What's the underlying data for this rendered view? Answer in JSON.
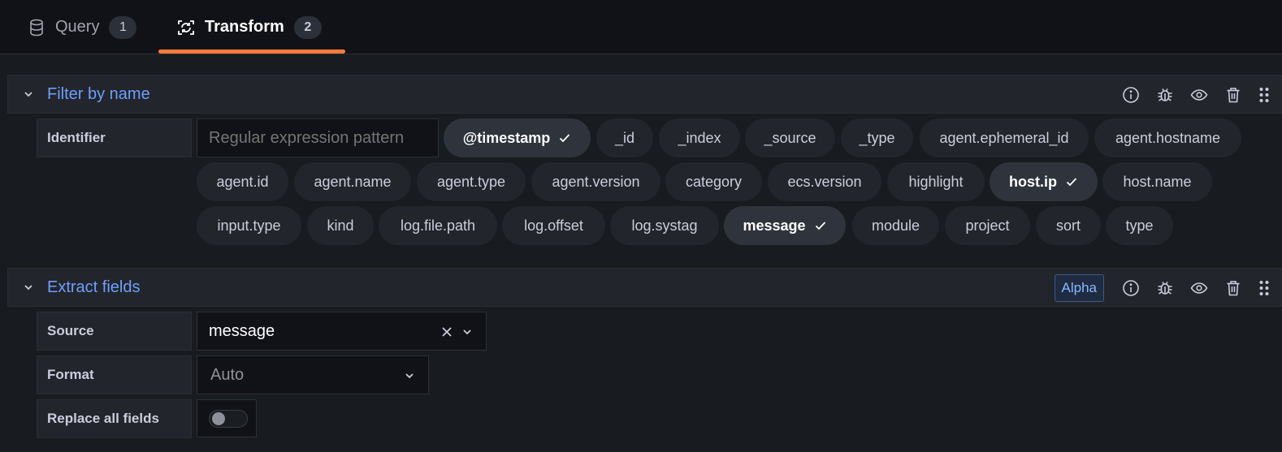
{
  "tabs": [
    {
      "label": "Query",
      "count": "1",
      "icon": "database-icon"
    },
    {
      "label": "Transform",
      "count": "2",
      "icon": "transform-icon"
    }
  ],
  "filter": {
    "title": "Filter by name",
    "identifier_label": "Identifier",
    "pattern_placeholder": "Regular expression pattern",
    "fields": [
      {
        "label": "@timestamp",
        "selected": true
      },
      {
        "label": "_id",
        "selected": false
      },
      {
        "label": "_index",
        "selected": false
      },
      {
        "label": "_source",
        "selected": false
      },
      {
        "label": "_type",
        "selected": false
      },
      {
        "label": "agent.ephemeral_id",
        "selected": false
      },
      {
        "label": "agent.hostname",
        "selected": false
      },
      {
        "label": "agent.id",
        "selected": false
      },
      {
        "label": "agent.name",
        "selected": false
      },
      {
        "label": "agent.type",
        "selected": false
      },
      {
        "label": "agent.version",
        "selected": false
      },
      {
        "label": "category",
        "selected": false
      },
      {
        "label": "ecs.version",
        "selected": false
      },
      {
        "label": "highlight",
        "selected": false
      },
      {
        "label": "host.ip",
        "selected": true
      },
      {
        "label": "host.name",
        "selected": false
      },
      {
        "label": "input.type",
        "selected": false
      },
      {
        "label": "kind",
        "selected": false
      },
      {
        "label": "log.file.path",
        "selected": false
      },
      {
        "label": "log.offset",
        "selected": false
      },
      {
        "label": "log.systag",
        "selected": false
      },
      {
        "label": "message",
        "selected": true
      },
      {
        "label": "module",
        "selected": false
      },
      {
        "label": "project",
        "selected": false
      },
      {
        "label": "sort",
        "selected": false
      },
      {
        "label": "type",
        "selected": false
      }
    ]
  },
  "extract": {
    "title": "Extract fields",
    "badge": "Alpha",
    "source_label": "Source",
    "source_value": "message",
    "format_label": "Format",
    "format_value": "Auto",
    "replace_label": "Replace all fields",
    "replace_on": false
  },
  "colors": {
    "accent": "#6e9fff",
    "tab_underline": "#ff7a3d",
    "background": "#181b1f"
  }
}
